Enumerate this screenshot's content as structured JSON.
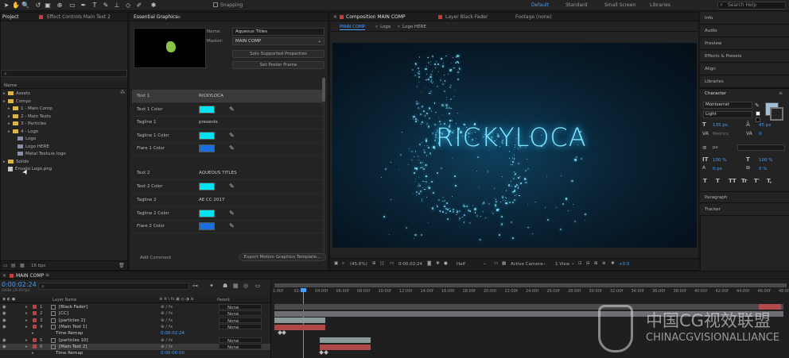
{
  "toolbar": {
    "snapping_label": "Snapping",
    "workspaces": [
      "Default",
      "Standard",
      "Small Screen",
      "Libraries"
    ],
    "active_workspace": "Default",
    "search_placeholder": "Search Help"
  },
  "project_panel": {
    "tabs": [
      "Project",
      "Effect Controls Main Text 2"
    ],
    "search_placeholder": "",
    "column_name": "Name",
    "items": [
      {
        "label": "Assets",
        "type": "folder",
        "indent": 0
      },
      {
        "label": "Comps",
        "type": "folder",
        "indent": 0
      },
      {
        "label": "1 - Main Comp",
        "type": "folder",
        "indent": 1
      },
      {
        "label": "2 - Main Texts",
        "type": "folder",
        "indent": 1
      },
      {
        "label": "3 - Particles",
        "type": "folder",
        "indent": 1
      },
      {
        "label": "4 - Logo",
        "type": "folder",
        "indent": 1
      },
      {
        "label": "Logo",
        "type": "comp",
        "indent": 2
      },
      {
        "label": "Logo HERE",
        "type": "comp",
        "indent": 2
      },
      {
        "label": "Metal Texture logo",
        "type": "comp",
        "indent": 2
      },
      {
        "label": "Solids",
        "type": "folder",
        "indent": 0
      },
      {
        "label": "Envato Logo.png",
        "type": "file",
        "indent": 0
      }
    ],
    "footer_bpc": "16 bpc"
  },
  "essential_graphics": {
    "tab": "Essential Graphics",
    "name_label": "Name:",
    "name_value": "Aqueous Titles",
    "master_label": "Master:",
    "master_value": "MAIN COMP",
    "solo_button": "Solo Supported Properties",
    "poster_button": "Set Poster Frame",
    "rows": [
      {
        "label": "Text 1",
        "value": "RICKYLOCA",
        "kind": "text",
        "highlight": true
      },
      {
        "label": "Text 1 Color",
        "color": "#00e5f0",
        "kind": "color"
      },
      {
        "label": "Tagline 1",
        "value": "presents",
        "kind": "text"
      },
      {
        "label": "Tagline 1 Color",
        "color": "#00e5f0",
        "kind": "color"
      },
      {
        "label": "Flare 1 Color",
        "color": "#1a6fe0",
        "kind": "color"
      },
      {
        "label": "Text 2",
        "value": "AQUEOUS TITLES",
        "kind": "text"
      },
      {
        "label": "Text 2 Color",
        "color": "#00e5f0",
        "kind": "color"
      },
      {
        "label": "Tagline 2",
        "value": "AE CC 2017",
        "kind": "text"
      },
      {
        "label": "Tagline 2 Color",
        "color": "#00e5f0",
        "kind": "color"
      },
      {
        "label": "Flare 2 Color",
        "color": "#1a6fe0",
        "kind": "color"
      }
    ],
    "add_comment": "Add Comment",
    "export_button": "Export Motion Graphics Template..."
  },
  "composition": {
    "tabs": [
      "Composition MAIN COMP",
      "Layer Black Fader",
      "Footage (none)"
    ],
    "breadcrumbs": [
      "MAIN COMP",
      "Logo",
      "Logo HERE"
    ],
    "title_text": "RICKYLOCA",
    "footer": {
      "zoom": "(45.6%)",
      "timecode": "0:00:02:24",
      "resolution": "Half",
      "camera": "Active Camera",
      "views": "1 View",
      "exposure": "+0.0"
    }
  },
  "right_panel": {
    "items": [
      "Info",
      "Audio",
      "Preview",
      "Effects & Presets",
      "Align",
      "Libraries"
    ],
    "character": {
      "title": "Character",
      "font": "Montserrat",
      "style": "Light",
      "size": "135 px",
      "leading": "45 px",
      "tracking": "0",
      "metrics": "Metrics",
      "unit": "px",
      "vscale": "100 %",
      "hscale": "100 %",
      "baseline": "0 px",
      "tsume": "0 %",
      "styles": [
        "T",
        "T",
        "TT",
        "Tr",
        "T'",
        "T,"
      ]
    },
    "paragraph": "Paragraph",
    "tracker": "Tracker"
  },
  "timeline": {
    "tab": "MAIN COMP",
    "timecode": "0:00:02:24",
    "fps": "00084 (30.00 fps)",
    "headers": {
      "layer_name": "Layer Name",
      "parent": "Parent"
    },
    "ruler": [
      "1:00f",
      "02:00f",
      "04:00f",
      "06:00f",
      "08:00f",
      "10:00f",
      "12:00f",
      "14:00f",
      "16:00f",
      "18:00f",
      "20:00f",
      "22:00f",
      "24:00f",
      "26:00f",
      "28:00f",
      "30:00f",
      "32:00f",
      "34:00f",
      "36:00f",
      "38:00f",
      "40:00f",
      "42:00f",
      "44:00f",
      "46:00f",
      "48:00f"
    ],
    "layers": [
      {
        "num": "1",
        "name": "[Black Fader]",
        "parent": "None",
        "color": "#c43c3c"
      },
      {
        "num": "2",
        "name": "[CC]",
        "parent": "None",
        "color": "#c43c3c"
      },
      {
        "num": "3",
        "name": "[particles 2]",
        "parent": "None",
        "color": "#c43c3c"
      },
      {
        "num": "4",
        "name": "[Main Text 1]",
        "parent": "None",
        "color": "#c43c3c"
      },
      {
        "num": "",
        "name": "Time Remap",
        "parent": "0:00:02:24",
        "color": ""
      },
      {
        "num": "5",
        "name": "[particles 10]",
        "parent": "None",
        "color": "#c43c3c"
      },
      {
        "num": "6",
        "name": "[Main Text 2]",
        "parent": "None",
        "color": "#c43c3c"
      },
      {
        "num": "",
        "name": "Time Remap",
        "parent": "0:00:00:00",
        "color": ""
      }
    ]
  },
  "watermark": {
    "cn": "中国CG视效联盟",
    "en": "CHINACGVISIONALLIANCE"
  }
}
